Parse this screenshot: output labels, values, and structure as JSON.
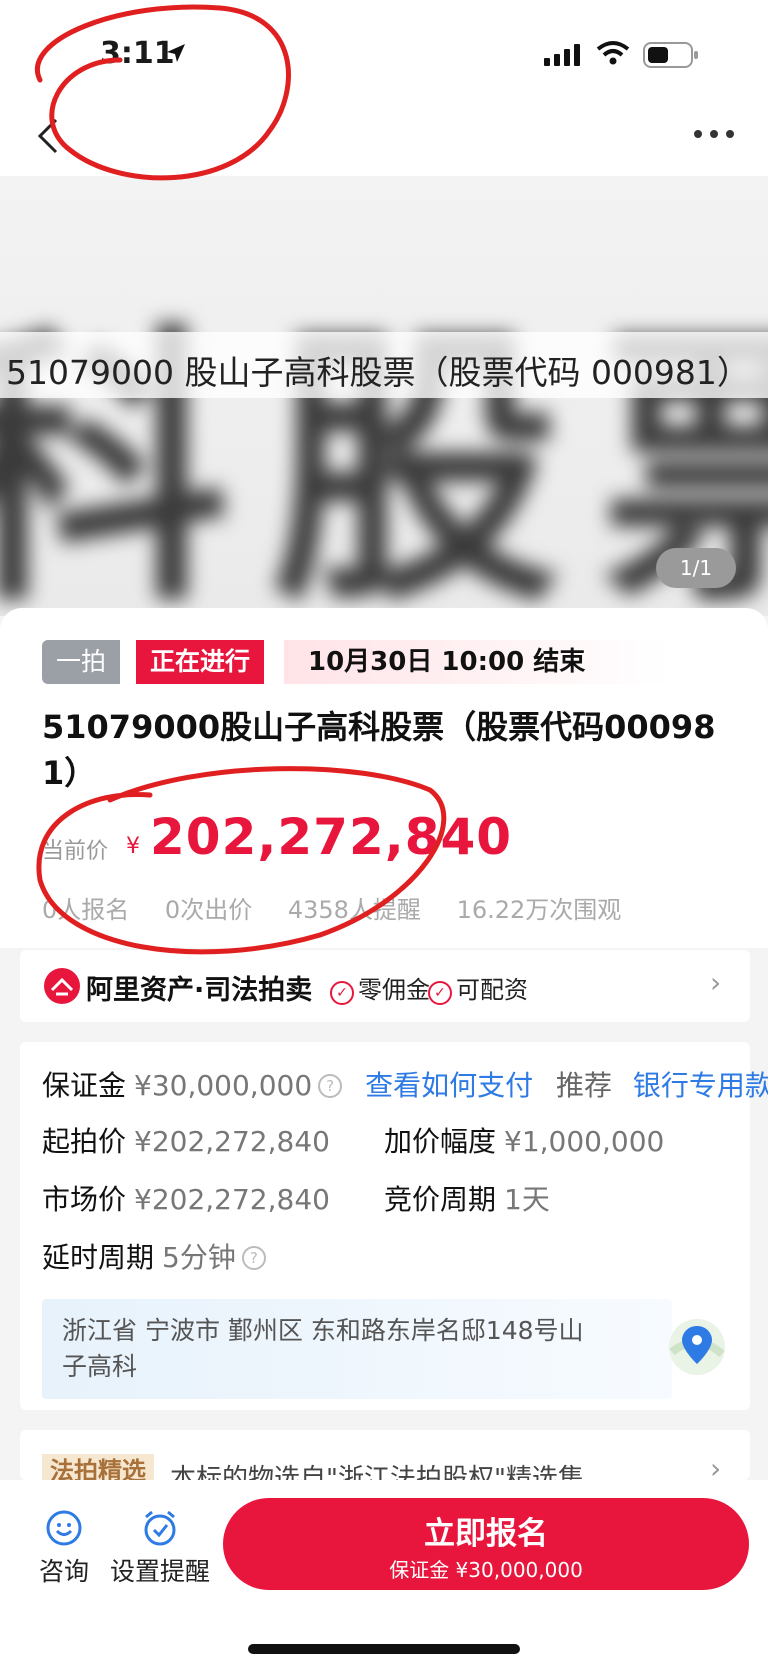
{
  "status_bar": {
    "time": "3:11"
  },
  "banner": {
    "blurred_text": "科股票",
    "caption": "51079000 股山子高科股票（股票代码 000981）",
    "page_counter": "1/1"
  },
  "auction": {
    "round_tag": "一拍",
    "status_tag": "正在进行",
    "end_time": "10月30日  10:00  结束",
    "title": "51079000股山子高科股票（股票代码000981）",
    "current_price_label": "当前价",
    "currency": "¥",
    "current_price": "202,272,840",
    "stats": [
      "0人报名",
      "0次出价",
      "4358人提醒",
      "16.22万次围观"
    ]
  },
  "brand": {
    "name": "阿里资产·司法拍卖",
    "features": [
      "零佣金",
      "可配资"
    ]
  },
  "details": {
    "deposit_label": "保证金",
    "deposit_value": "¥30,000,000",
    "how_to_pay_link": "查看如何支付",
    "recommend_label": "推荐",
    "recommend_link": "银行专用款",
    "start_price_label": "起拍价",
    "start_price_value": "¥202,272,840",
    "increment_label": "加价幅度",
    "increment_value": "¥1,000,000",
    "market_price_label": "市场价",
    "market_price_value": "¥202,272,840",
    "bid_period_label": "竞价周期",
    "bid_period_value": "1天",
    "delay_label": "延时周期",
    "delay_value": "5分钟",
    "address": "浙江省 宁波市 鄞州区 东和路东岸名邸148号山子高科"
  },
  "featured": {
    "tag": "法拍精选",
    "text": "本标的物选自\"浙江法拍股权\"精选集"
  },
  "bottom_bar": {
    "consult_label": "咨询",
    "reminder_label": "设置提醒",
    "signup_label": "立即报名",
    "signup_sub": "保证金 ¥30,000,000"
  },
  "colors": {
    "accent": "#e8163c",
    "link": "#2e7be5",
    "annotation": "#e02020"
  }
}
